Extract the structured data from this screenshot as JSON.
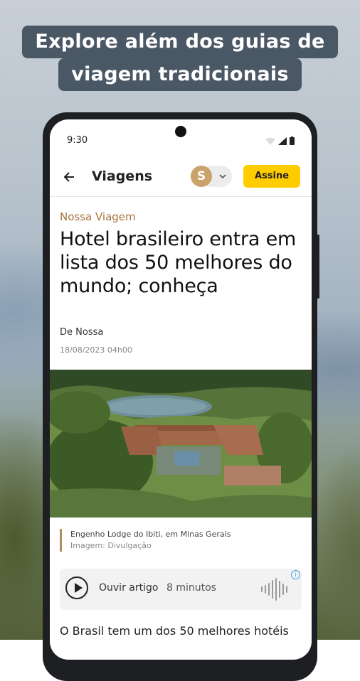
{
  "promo": {
    "headline_line1": "Explore além dos guias de",
    "headline_line2": "viagem tradicionais"
  },
  "status_bar": {
    "time": "9:30"
  },
  "app_bar": {
    "section_title": "Viagens",
    "avatar_letter": "S",
    "subscribe_label": "Assine"
  },
  "article": {
    "kicker": "Nossa Viagem",
    "title": "Hotel brasileiro entra em lista dos 50 melhores do mundo; conheça",
    "byline": "De Nossa",
    "date": "18/08/2023 04h00",
    "caption_text": "Engenho Lodge do Ibiti, em Minas Gerais",
    "caption_credit": "Imagem: Divulgação",
    "body_start": "O Brasil tem um dos 50 melhores hotéis"
  },
  "audio_player": {
    "listen_label": "Ouvir artigo",
    "duration": "8 minutos",
    "ad_info": "i"
  },
  "colors": {
    "accent_yellow": "#ffcc00",
    "kicker_gold": "#a6763a",
    "avatar_bg": "#c9a36b",
    "headline_bg": "#4a5866"
  },
  "icons": [
    "back-arrow-icon",
    "wifi-icon",
    "signal-icon",
    "battery-icon",
    "chevron-down-icon",
    "play-icon",
    "soundwave-icon",
    "info-icon"
  ]
}
